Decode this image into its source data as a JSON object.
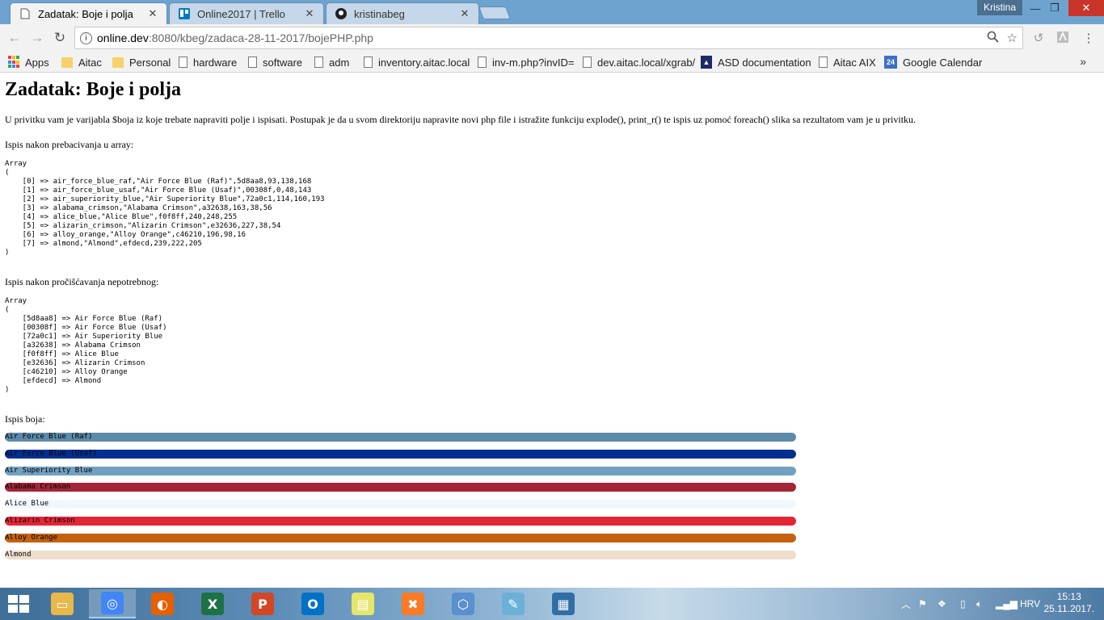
{
  "tabs": [
    {
      "title": "Zadatak: Boje i polja",
      "icon": "page-icon",
      "active": true
    },
    {
      "title": "Online2017 | Trello",
      "icon": "trello-icon",
      "active": false
    },
    {
      "title": "kristinabeg",
      "icon": "github-icon",
      "active": false
    }
  ],
  "profile": {
    "name": "Kristina"
  },
  "address": {
    "host": "online.dev",
    "rest": ":8080/kbeg/zadaca-28-11-2017/bojePHP.php"
  },
  "bookmarks": [
    {
      "label": "Apps",
      "icon": "apps-grid-icon"
    },
    {
      "label": "Aitac",
      "icon": "folder-icon"
    },
    {
      "label": "Personal",
      "icon": "folder-icon"
    },
    {
      "label": "hardware",
      "icon": "page-icon"
    },
    {
      "label": "software",
      "icon": "page-icon"
    },
    {
      "label": "adm",
      "icon": "page-icon"
    },
    {
      "label": "inventory.aitac.local",
      "icon": "page-icon"
    },
    {
      "label": "inv-m.php?invID=",
      "icon": "page-icon"
    },
    {
      "label": "dev.aitac.local/xgrab/",
      "icon": "page-icon"
    },
    {
      "label": "ASD documentation",
      "icon": "asd-icon"
    },
    {
      "label": "Aitac AIX",
      "icon": "page-icon"
    },
    {
      "label": "Google Calendar",
      "icon": "calendar-icon",
      "badge": "24"
    }
  ],
  "content": {
    "heading": "Zadatak: Boje i polja",
    "intro": "U privitku vam je varijabla $boja iz koje trebate napraviti polje i ispisati. Postupak je da u svom direktoriju napravite novi php file i istražite funkciju explode(), print_r() te ispis uz pomoć foreach() slika sa rezultatom vam je u privitku.",
    "label_array": "Ispis nakon prebacivanja u array:",
    "array_raw": "Array\n(\n    [0] => air_force_blue_raf,\"Air Force Blue (Raf)\",5d8aa8,93,138,168\n    [1] => air_force_blue_usaf,\"Air Force Blue (Usaf)\",00308f,0,48,143\n    [2] => air_superiority_blue,\"Air Superiority Blue\",72a0c1,114,160,193\n    [3] => alabama_crimson,\"Alabama Crimson\",a32638,163,38,56\n    [4] => alice_blue,\"Alice Blue\",f0f8ff,240,248,255\n    [5] => alizarin_crimson,\"Alizarin Crimson\",e32636,227,38,54\n    [6] => alloy_orange,\"Alloy Orange\",c46210,196,98,16\n    [7] => almond,\"Almond\",efdecd,239,222,205\n)",
    "label_clean": "Ispis nakon pročišćavanja nepotrebnog:",
    "array_clean": "Array\n(\n    [5d8aa8] => Air Force Blue (Raf)\n    [00308f] => Air Force Blue (Usaf)\n    [72a0c1] => Air Superiority Blue\n    [a32638] => Alabama Crimson\n    [f0f8ff] => Alice Blue\n    [e32636] => Alizarin Crimson\n    [c46210] => Alloy Orange\n    [efdecd] => Almond\n)",
    "label_colors": "Ispis boja:",
    "colors": [
      {
        "name": "Air Force Blue (Raf)",
        "hex": "#5d8aa8"
      },
      {
        "name": "Air Force Blue (Usaf)",
        "hex": "#00308f"
      },
      {
        "name": "Air Superiority Blue",
        "hex": "#72a0c1"
      },
      {
        "name": "Alabama Crimson",
        "hex": "#a32638"
      },
      {
        "name": "Alice Blue",
        "hex": "#f0f8ff"
      },
      {
        "name": "Alizarin Crimson",
        "hex": "#e32636"
      },
      {
        "name": "Alloy Orange",
        "hex": "#c46210"
      },
      {
        "name": "Almond",
        "hex": "#efdecd"
      }
    ]
  },
  "taskbar": {
    "apps": [
      {
        "name": "file-explorer",
        "icon": "folder-icon",
        "color": "#e8b84a"
      },
      {
        "name": "chrome",
        "icon": "chrome-icon",
        "color": "#4285f4",
        "active": true
      },
      {
        "name": "firefox",
        "icon": "firefox-icon",
        "color": "#e66000"
      },
      {
        "name": "excel",
        "icon": "excel-icon",
        "color": "#1e7145"
      },
      {
        "name": "powerpoint",
        "icon": "powerpoint-icon",
        "color": "#d24726"
      },
      {
        "name": "outlook",
        "icon": "outlook-icon",
        "color": "#0072c6"
      },
      {
        "name": "sticky-notes",
        "icon": "notes-icon",
        "color": "#e6e66a"
      },
      {
        "name": "xampp",
        "icon": "xampp-icon",
        "color": "#fb7a24"
      },
      {
        "name": "virtualbox",
        "icon": "cube-icon",
        "color": "#5a8fd0"
      },
      {
        "name": "editor",
        "icon": "pen-icon",
        "color": "#6ab0d8"
      },
      {
        "name": "photos",
        "icon": "photo-icon",
        "color": "#2f6fa5"
      }
    ],
    "language": "HRV",
    "time": "15:13",
    "date": "25.11.2017."
  }
}
